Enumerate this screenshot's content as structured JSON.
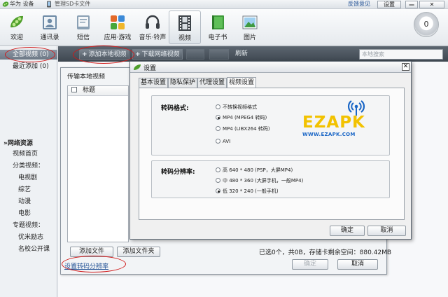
{
  "titlebar": {
    "device": "华为 设备",
    "sd_card": "管理SD卡文件",
    "feedback": "反馈意见",
    "settings": "设置",
    "min": "—",
    "close": "✕"
  },
  "toolbar": {
    "items": [
      {
        "label": "欢迎",
        "icon": "peapod-icon"
      },
      {
        "label": "通讯录",
        "icon": "contacts-icon"
      },
      {
        "label": "短信",
        "icon": "sms-icon"
      },
      {
        "label": "应用·游戏",
        "icon": "apps-icon"
      },
      {
        "label": "音乐·铃声",
        "icon": "headphones-icon"
      },
      {
        "label": "视频",
        "icon": "film-icon"
      },
      {
        "label": "电子书",
        "icon": "ebook-icon"
      },
      {
        "label": "图片",
        "icon": "picture-icon"
      }
    ],
    "active": "视频",
    "task_count": "0"
  },
  "sidebar": {
    "items": [
      {
        "label": "全部视频 (0)",
        "selected": true
      },
      {
        "label": "最近添加 (0)"
      }
    ],
    "network_heading": "»网络资源",
    "network_items": [
      "视频首页",
      "分类视频：",
      "电视剧",
      "综艺",
      "动漫",
      "电影",
      "专题视频：",
      "优米励志",
      "名校公开课"
    ]
  },
  "actionbar": {
    "add_local": "添加本地视频",
    "download_network": "下载网络视频",
    "refresh": "刷新",
    "search_placeholder": "本地搜索"
  },
  "transfer_panel": {
    "title": "传输本地视频",
    "list_header": "标题",
    "add_file": "添加文件",
    "add_folder": "添加文件夹",
    "transcode_link": "设置转码分辨率",
    "status": "已选0个，共0B，存储卡剩余空间：880.42MB",
    "ok": "确定",
    "cancel": "取消"
  },
  "settings_dialog": {
    "title": "设置",
    "close": "✕",
    "tabs": [
      "基本设置",
      "隐私保护",
      "代理设置",
      "视频设置"
    ],
    "active_tab": "视频设置",
    "format_label": "转码格式:",
    "format_options": [
      {
        "label": "不转换视频格式",
        "checked": false
      },
      {
        "label": "MP4 (MPEG4 转码)",
        "checked": true
      },
      {
        "label": "MP4 (LIBX264 转码)",
        "checked": false
      },
      {
        "label": "AVI",
        "checked": false
      }
    ],
    "resolution_label": "转码分辨率:",
    "resolution_options": [
      {
        "label": "高 640 * 480 (PSP，大屏MP4)",
        "checked": false
      },
      {
        "label": "中 480 * 360 (大屏手机，一般MP4)",
        "checked": false
      },
      {
        "label": "低 320 * 240 (一般手机)",
        "checked": true
      }
    ],
    "ok": "确定",
    "cancel": "取消"
  },
  "watermark": {
    "brand": "EZAPK",
    "url": "WWW.EZAPK.COM"
  },
  "colors": {
    "annotation": "#d01818",
    "link": "#1f4f94",
    "watermark_yellow": "#f2c200",
    "watermark_blue": "#1a66c6"
  }
}
